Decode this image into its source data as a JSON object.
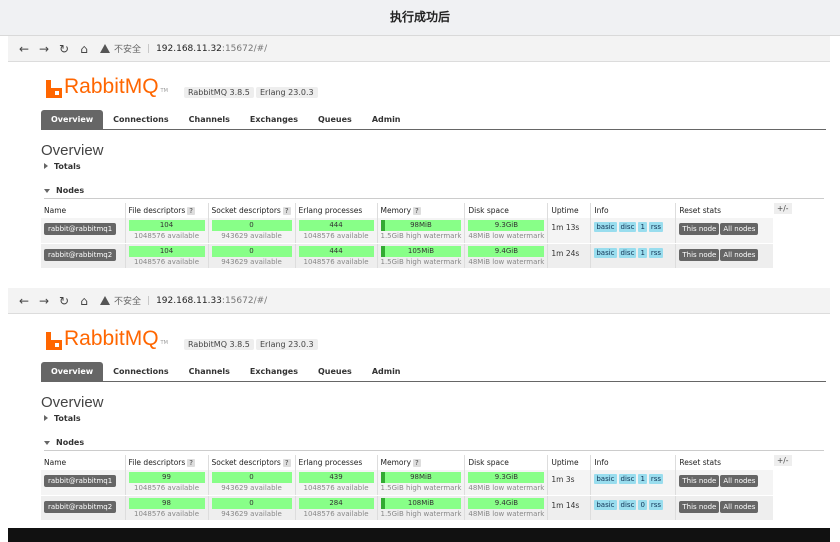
{
  "page_title": "执行成功后",
  "browser": {
    "insecure_label": "不安全",
    "separator": "|"
  },
  "panels": [
    {
      "url_host": "192.168.11.32",
      "url_rest": ":15672/#/",
      "logo_text": "RabbitMQ",
      "logo_tm": "TM",
      "rabbitmq_version": "RabbitMQ 3.8.5",
      "erlang_version": "Erlang 23.0.3",
      "tabs": [
        "Overview",
        "Connections",
        "Channels",
        "Exchanges",
        "Queues",
        "Admin"
      ],
      "overview_title": "Overview",
      "totals_label": "Totals",
      "nodes_label": "Nodes",
      "columns": [
        "Name",
        "File descriptors",
        "Socket descriptors",
        "Erlang processes",
        "Memory",
        "Disk space",
        "Uptime",
        "Info",
        "Reset stats"
      ],
      "help_mark": "?",
      "plus_minus": "+/-",
      "rows": [
        {
          "name": "rabbit@rabbitmq1",
          "fd": "104",
          "fd_avail": "1048576 available",
          "sock": "0",
          "sock_avail": "943629 available",
          "erl": "444",
          "erl_avail": "1048576 available",
          "mem": "98MiB",
          "mem_sub": "1.5GiB high watermark",
          "disk": "9.3GiB",
          "disk_sub": "48MiB low watermark",
          "uptime": "1m 13s",
          "info": [
            "basic",
            "disc",
            "1",
            "rss"
          ],
          "btn_this": "This node",
          "btn_all": "All nodes"
        },
        {
          "name": "rabbit@rabbitmq2",
          "fd": "104",
          "fd_avail": "1048576 available",
          "sock": "0",
          "sock_avail": "943629 available",
          "erl": "444",
          "erl_avail": "1048576 available",
          "mem": "105MiB",
          "mem_sub": "1.5GiB high watermark",
          "disk": "9.4GiB",
          "disk_sub": "48MiB low watermark",
          "uptime": "1m 24s",
          "info": [
            "basic",
            "disc",
            "1",
            "rss"
          ],
          "btn_this": "This node",
          "btn_all": "All nodes"
        }
      ]
    },
    {
      "url_host": "192.168.11.33",
      "url_rest": ":15672/#/",
      "logo_text": "RabbitMQ",
      "logo_tm": "TM",
      "rabbitmq_version": "RabbitMQ 3.8.5",
      "erlang_version": "Erlang 23.0.3",
      "tabs": [
        "Overview",
        "Connections",
        "Channels",
        "Exchanges",
        "Queues",
        "Admin"
      ],
      "overview_title": "Overview",
      "totals_label": "Totals",
      "nodes_label": "Nodes",
      "columns": [
        "Name",
        "File descriptors",
        "Socket descriptors",
        "Erlang processes",
        "Memory",
        "Disk space",
        "Uptime",
        "Info",
        "Reset stats"
      ],
      "help_mark": "?",
      "plus_minus": "+/-",
      "rows": [
        {
          "name": "rabbit@rabbitmq1",
          "fd": "99",
          "fd_avail": "1048576 available",
          "sock": "0",
          "sock_avail": "943629 available",
          "erl": "439",
          "erl_avail": "1048576 available",
          "mem": "98MiB",
          "mem_sub": "1.5GiB high watermark",
          "disk": "9.3GiB",
          "disk_sub": "48MiB low watermark",
          "uptime": "1m 3s",
          "info": [
            "basic",
            "disc",
            "1",
            "rss"
          ],
          "btn_this": "This node",
          "btn_all": "All nodes"
        },
        {
          "name": "rabbit@rabbitmq2",
          "fd": "98",
          "fd_avail": "1048576 available",
          "sock": "0",
          "sock_avail": "943629 available",
          "erl": "284",
          "erl_avail": "1048576 available",
          "mem": "108MiB",
          "mem_sub": "1.5GiB high watermark",
          "disk": "9.4GiB",
          "disk_sub": "48MiB low watermark",
          "uptime": "1m 14s",
          "info": [
            "basic",
            "disc",
            "0",
            "rss"
          ],
          "btn_this": "This node",
          "btn_all": "All nodes"
        }
      ]
    }
  ]
}
